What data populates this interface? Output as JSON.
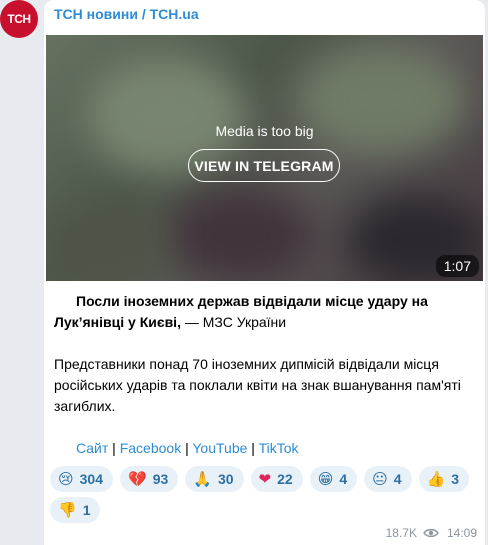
{
  "channel": {
    "avatar_text": "ТСН",
    "name": "ТСН новини / TCH.ua",
    "brand_color": "#c8102e",
    "link_color": "#2d8cd3"
  },
  "media": {
    "notice": "Media is too big",
    "button_label": "VIEW IN TELEGRAM",
    "duration": "1:07"
  },
  "post": {
    "headline_bold": "Посли іноземних держав відвідали місце удару на Лук’янівці у Києві,",
    "headline_source": " — МЗС України",
    "body": "Представники понад 70 іноземних дипмісій відвідали місця російських ударів та поклали квіти на знак вшанування пам'яті загиблих."
  },
  "links": [
    {
      "label": "Сайт"
    },
    {
      "label": "Facebook"
    },
    {
      "label": "YouTube"
    },
    {
      "label": "TikTok"
    }
  ],
  "link_separator": " | ",
  "reactions": [
    {
      "icon": "crying-face-icon",
      "emoji": "😢",
      "count": "304"
    },
    {
      "icon": "broken-heart-icon",
      "emoji": "💔",
      "count": "93"
    },
    {
      "icon": "praying-hands-icon",
      "emoji": "🙏",
      "count": "30"
    },
    {
      "icon": "red-heart-icon",
      "emoji": "❤",
      "count": "22"
    },
    {
      "icon": "grinning-face-icon",
      "emoji": "😁",
      "count": "4"
    },
    {
      "icon": "neutral-face-icon",
      "emoji": "😐",
      "count": "4"
    },
    {
      "icon": "thumbs-up-icon",
      "emoji": "👍",
      "count": "3"
    },
    {
      "icon": "thumbs-down-icon",
      "emoji": "👎",
      "count": "1"
    }
  ],
  "meta": {
    "views": "18.7K",
    "time": "14:09"
  }
}
